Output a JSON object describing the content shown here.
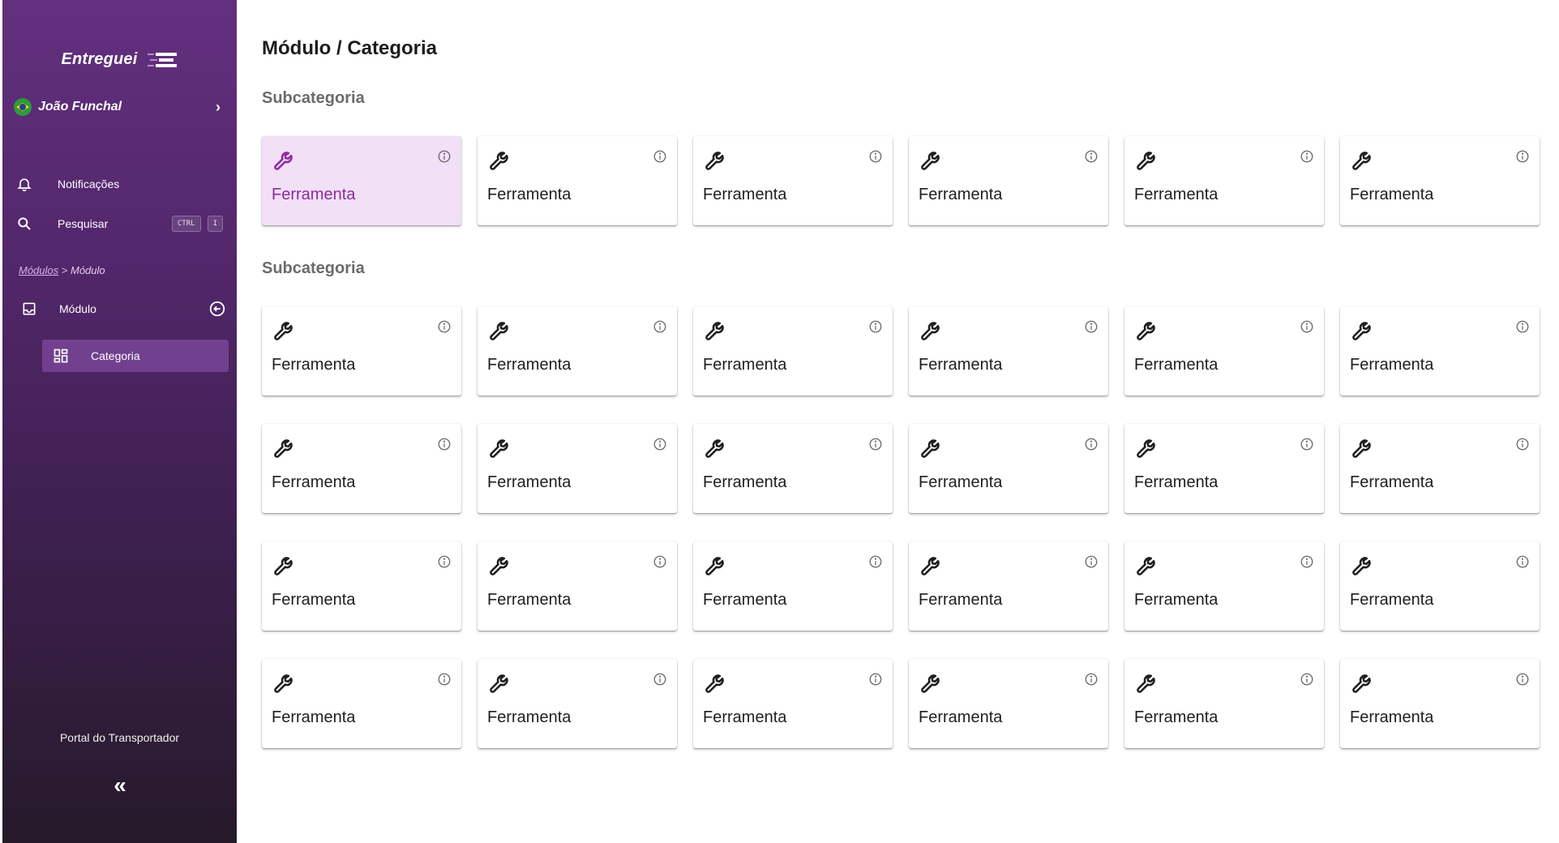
{
  "sidebar": {
    "brand": "Entreguei",
    "user": "João Funchal",
    "nav": {
      "notifications": "Notificações",
      "search": "Pesquisar",
      "kbd_ctrl": "CTRL",
      "kbd_key": "I"
    },
    "breadcrumb": {
      "root": "Módulos",
      "separator": ">",
      "current": "Módulo"
    },
    "module": "Módulo",
    "category": "Categoria",
    "portal": "Portal do Transportador",
    "collapse_glyph": "«"
  },
  "main": {
    "title_module": "Módulo",
    "title_category": " / Categoria",
    "sections": [
      {
        "title": "Subcategoria",
        "tools": [
          "Ferramenta",
          "Ferramenta",
          "Ferramenta",
          "Ferramenta",
          "Ferramenta",
          "Ferramenta"
        ]
      },
      {
        "title": "Subcategoria",
        "tools": [
          "Ferramenta",
          "Ferramenta",
          "Ferramenta",
          "Ferramenta",
          "Ferramenta",
          "Ferramenta",
          "Ferramenta",
          "Ferramenta",
          "Ferramenta",
          "Ferramenta",
          "Ferramenta",
          "Ferramenta",
          "Ferramenta",
          "Ferramenta",
          "Ferramenta",
          "Ferramenta",
          "Ferramenta",
          "Ferramenta",
          "Ferramenta",
          "Ferramenta",
          "Ferramenta",
          "Ferramenta",
          "Ferramenta",
          "Ferramenta"
        ]
      }
    ],
    "active_tool": {
      "section": 0,
      "index": 0
    }
  },
  "icons": {
    "tool": "wrench-icon",
    "info": "info-icon"
  },
  "colors": {
    "accent": "#8f2aa0",
    "active_card_bg": "#f1e0f6",
    "sidebar_top": "#63307f",
    "sidebar_bottom": "#261a2a"
  }
}
